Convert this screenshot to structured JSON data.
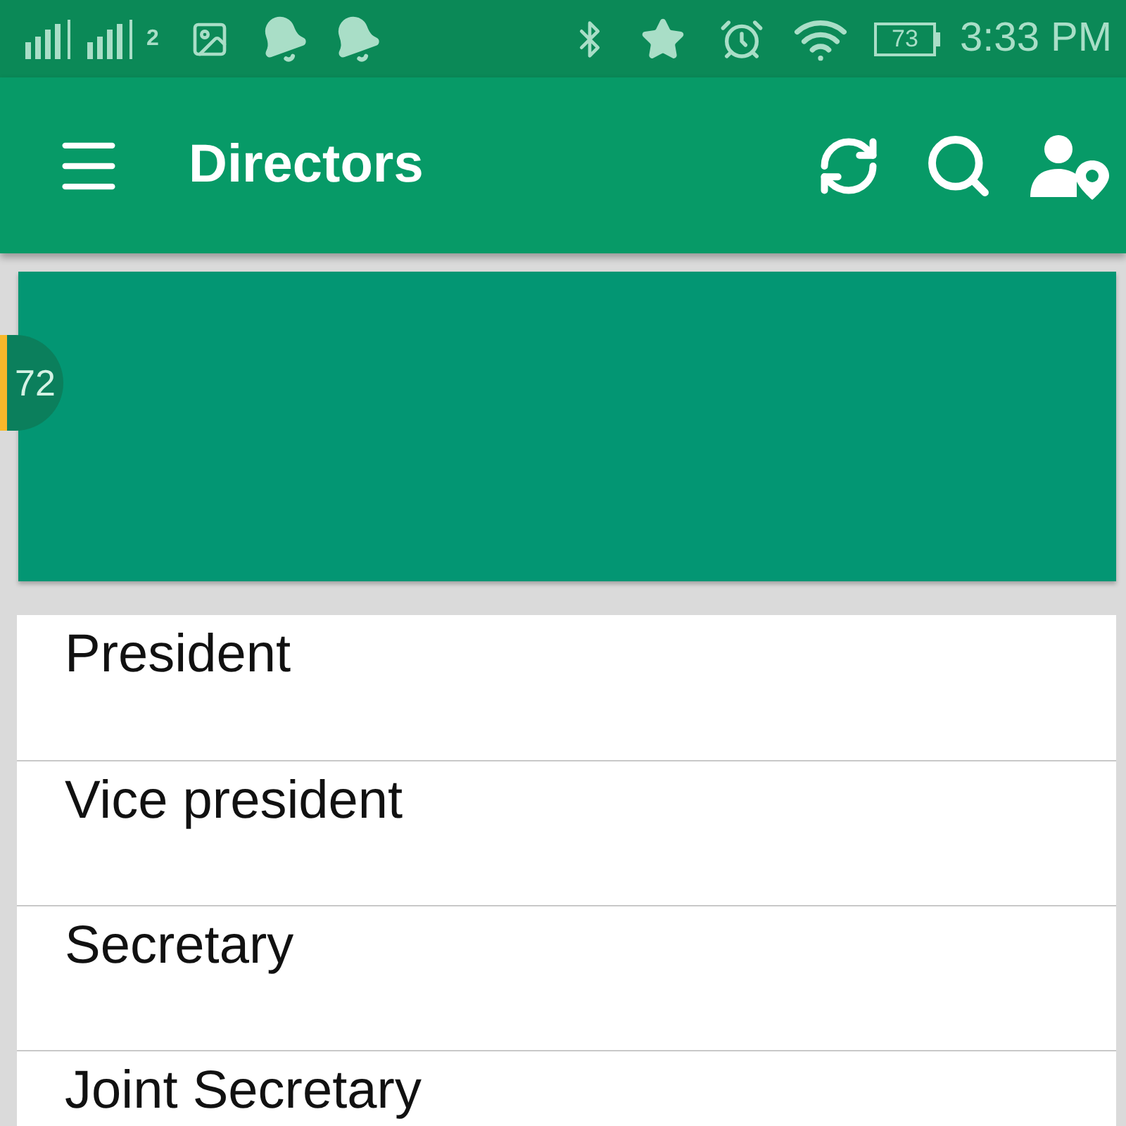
{
  "status_bar": {
    "sim_number": "2",
    "battery": "73",
    "time": "3:33 PM"
  },
  "app_bar": {
    "title": "Directors"
  },
  "banner": {
    "scroll_index": "72"
  },
  "list": [
    {
      "label": "President"
    },
    {
      "label": "Vice president"
    },
    {
      "label": "Secretary"
    },
    {
      "label": "Joint Secretary"
    }
  ]
}
